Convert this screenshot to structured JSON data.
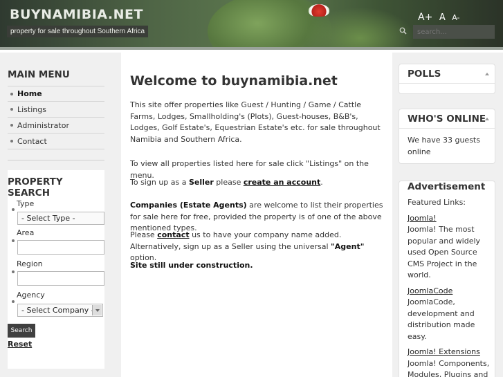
{
  "header": {
    "site_title": "BUYNAMIBIA.NET",
    "tagline": "property for sale throughout Southern Africa",
    "font_size_tools": {
      "large": "A+",
      "normal": "A",
      "small": "A-"
    },
    "search": {
      "placeholder": "search...",
      "icon": "search-icon"
    }
  },
  "main_menu": {
    "title": "MAIN MENU",
    "items": [
      {
        "label": "Home",
        "active": true
      },
      {
        "label": "Listings",
        "active": false
      },
      {
        "label": "Administrator",
        "active": false
      },
      {
        "label": "Contact",
        "active": false
      }
    ]
  },
  "property_search": {
    "title": "PROPERTY SEARCH",
    "type_label": "Type",
    "type_selected": "- Select Type -",
    "area_label": "Area",
    "region_label": "Region",
    "agency_label": "Agency",
    "agency_selected": "- Select Company -",
    "search_button": "Search",
    "reset_link": "Reset"
  },
  "content": {
    "title": "Welcome to buynamibia.net",
    "p1": "This site offer properties like Guest / Hunting / Game / Cattle Farms, Lodges, Smallholding's (Plots), Guest-houses, B&B's, Lodges, Golf Estate's, Equestrian Estate's etc. for sale throughout Namibia and Southern Africa.",
    "p2": "To view all properties listed here for sale click \"Listings\" on the menu.",
    "p3_before": "To sign up as a ",
    "p3_bold": "Seller",
    "p3_mid": " please ",
    "p3_link": "create an account",
    "p3_after": ".",
    "p4_bold": "Companies (Estate Agents)",
    "p4_rest": " are welcome to list their properties for sale here for free, provided the property is of one of the above mentioned types.",
    "p5_before": "Please ",
    "p5_link": "contact",
    "p5_mid": " us to have your company name added. Alternatively, sign up as a Seller using the universal ",
    "p5_bold": "\"Agent\"",
    "p5_after": " option.",
    "p6": "Site still under construction."
  },
  "right": {
    "polls_title": "POLLS",
    "online_title": "WHO'S ONLINE",
    "online_text": "We have 33 guests online",
    "advert_title": "Advertisement",
    "featured_label": "Featured Links:",
    "links": [
      {
        "title": "Joomla!",
        "desc": "Joomla! The most popular and widely used Open Source CMS Project in the world."
      },
      {
        "title": "JoomlaCode",
        "desc": "JoomlaCode, development and distribution made easy."
      },
      {
        "title": "Joomla! Extensions",
        "desc": "Joomla! Components, Modules, Plugins and"
      }
    ]
  },
  "colors": {
    "header_bg": "#4f6546",
    "accent_dark": "#404040",
    "frog_red": "#e23b2f"
  }
}
